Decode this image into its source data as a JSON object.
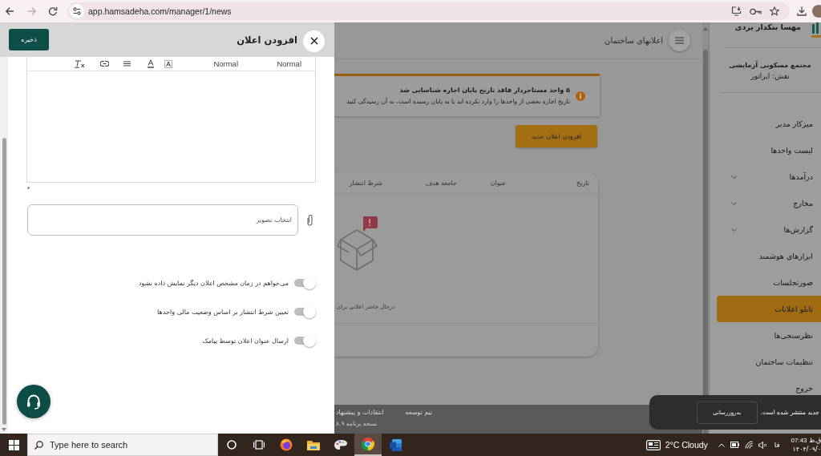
{
  "browser": {
    "url": "app.hamsadeha.com/manager/1/news"
  },
  "drawer": {
    "title": "افزودن اعلان",
    "save": "ذخیره",
    "editor": {
      "formats": [
        "Normal",
        "Normal"
      ]
    },
    "image_field": {
      "placeholder": "انتخاب تصویر"
    },
    "toggles": [
      {
        "label": "می‌خواهم در زمان مشخص اعلان دیگر نمایش داده نشود",
        "on": false
      },
      {
        "label": "تعیین شرط انتشار بر اساس وضعیت مالی واحدها",
        "on": false
      },
      {
        "label": "ارسال عنوان اعلان توسط پیامک",
        "on": false
      }
    ]
  },
  "page": {
    "title": "اعلانهای ساختمان",
    "alert": {
      "title": "۵ واحد مستاجردار فاقد تاریخ پایان اجاره شناسایی شد",
      "message": "تاریخ اجاره بعضی از واحدها را وارد نکرده اید یا به پایان رسیده است، به آن رسیدگی کنید"
    },
    "add_button": "افزودن اعلان جدید",
    "table": {
      "columns": [
        "تاریخ",
        "عنوان",
        "جامعه هدف",
        "شرط انتشار"
      ],
      "empty_text": "درحال حاضر اعلانی برای"
    },
    "footer": {
      "links": [
        "تیم توسعه",
        "انتقادات و پیشنهاد"
      ],
      "version": "نسخه برنامه ۸.۹"
    }
  },
  "sidebar": {
    "user_name": "مهسا بنکدار یزدی",
    "building": "مجتمع مسکونی آزمایشی",
    "role": "نقش: اپراتور",
    "items": [
      {
        "label": "میزکار مدیر",
        "kind": "link",
        "selected": false
      },
      {
        "label": "لیست واحدها",
        "kind": "link",
        "selected": false
      },
      {
        "label": "درآمدها",
        "kind": "group",
        "selected": false
      },
      {
        "label": "مخارج",
        "kind": "group",
        "selected": false
      },
      {
        "label": "گزارش‌ها",
        "kind": "group",
        "selected": false
      },
      {
        "label": "ابزارهای هوشمند",
        "kind": "link",
        "selected": false
      },
      {
        "label": "صورتجلسات",
        "kind": "link",
        "selected": false
      },
      {
        "label": "تابلو اعلانات",
        "kind": "link",
        "selected": true
      },
      {
        "label": "نظرسنجی‌ها",
        "kind": "link",
        "selected": false
      },
      {
        "label": "تنظیمات ساختمان",
        "kind": "link",
        "selected": false
      },
      {
        "label": "خروج",
        "kind": "link",
        "selected": false
      }
    ]
  },
  "snackbar": {
    "message": "جدید منتشر شده است.",
    "action": "به‌روزرسانی"
  },
  "taskbar": {
    "search_placeholder": "Type here to search",
    "apps": [
      {
        "kind": "ring",
        "selected": false
      },
      {
        "kind": "tasks",
        "selected": false
      },
      {
        "kind": "flame",
        "selected": false
      },
      {
        "kind": "folder",
        "selected": false
      },
      {
        "kind": "palette",
        "selected": false
      },
      {
        "kind": "wheel",
        "selected": true
      },
      {
        "kind": "doc",
        "selected": false
      }
    ],
    "weather": "2°C Cloudy",
    "language": "فا",
    "time": "ق.ظ 07:43",
    "date": "۱۴۰۴/۰۹/۰"
  }
}
